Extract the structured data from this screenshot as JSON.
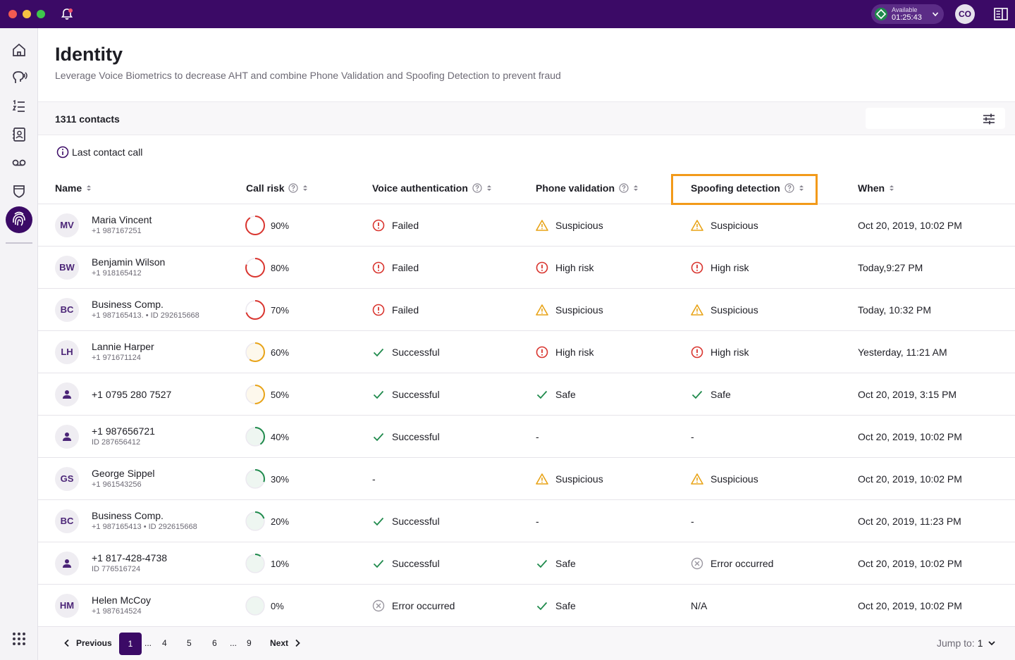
{
  "topbar": {
    "status_label": "Available",
    "status_time": "01:25:43",
    "user_initials": "CO"
  },
  "sidebar": {
    "items": [
      "home-icon",
      "speech-icon",
      "list-icon",
      "contacts-icon",
      "voicemail-icon",
      "shield-icon",
      "fingerprint-icon"
    ],
    "active": "fingerprint-icon"
  },
  "page": {
    "title": "Identity",
    "subtitle": "Leverage Voice Biometrics to decrease AHT and combine Phone Validation and Spoofing Detection to prevent fraud",
    "count": "1311 contacts",
    "info": "Last contact call"
  },
  "table": {
    "headers": {
      "name": "Name",
      "call_risk": "Call risk",
      "voice": "Voice authentication",
      "phone": "Phone validation",
      "spoof": "Spoofing detection",
      "when": "When"
    },
    "rows": [
      {
        "initials": "MV",
        "name": "Maria Vincent",
        "sub": "+1 987167251",
        "risk": "90%",
        "risk_value": 0.9,
        "voice": {
          "status": "failed",
          "text": "Failed"
        },
        "phone": {
          "status": "suspicious",
          "text": "Suspicious"
        },
        "spoof": {
          "status": "suspicious",
          "text": "Suspicious"
        },
        "when": "Oct 20, 2019, 10:02 PM"
      },
      {
        "initials": "BW",
        "name": "Benjamin Wilson",
        "sub": "+1 918165412",
        "risk": "80%",
        "risk_value": 0.8,
        "voice": {
          "status": "failed",
          "text": "Failed"
        },
        "phone": {
          "status": "high",
          "text": "High risk"
        },
        "spoof": {
          "status": "high",
          "text": "High risk"
        },
        "when": "Today,9:27 PM"
      },
      {
        "initials": "BC",
        "name": "Business Comp.",
        "sub": "+1 987165413. • ID 292615668",
        "risk": "70%",
        "risk_value": 0.7,
        "voice": {
          "status": "failed",
          "text": "Failed"
        },
        "phone": {
          "status": "suspicious",
          "text": "Suspicious"
        },
        "spoof": {
          "status": "suspicious",
          "text": "Suspicious"
        },
        "when": "Today, 10:32 PM"
      },
      {
        "initials": "LH",
        "name": "Lannie Harper",
        "sub": "+1 971671124",
        "risk": "60%",
        "risk_value": 0.6,
        "voice": {
          "status": "success",
          "text": "Successful"
        },
        "phone": {
          "status": "high",
          "text": "High risk"
        },
        "spoof": {
          "status": "high",
          "text": "High risk"
        },
        "when": "Yesterday, 11:21 AM"
      },
      {
        "initials": "",
        "name": "+1 0795 280 7527",
        "sub": "",
        "risk": "50%",
        "risk_value": 0.5,
        "voice": {
          "status": "success",
          "text": "Successful"
        },
        "phone": {
          "status": "success",
          "text": "Safe"
        },
        "spoof": {
          "status": "success",
          "text": "Safe"
        },
        "when": "Oct 20, 2019, 3:15 PM"
      },
      {
        "initials": "",
        "name": "+1 987656721",
        "sub": "ID 287656412",
        "risk": "40%",
        "risk_value": 0.4,
        "voice": {
          "status": "success",
          "text": "Successful"
        },
        "phone": {
          "status": "none",
          "text": "-"
        },
        "spoof": {
          "status": "none",
          "text": "-"
        },
        "when": "Oct 20, 2019, 10:02 PM"
      },
      {
        "initials": "GS",
        "name": "George Sippel",
        "sub": "+1 961543256",
        "risk": "30%",
        "risk_value": 0.3,
        "voice": {
          "status": "none",
          "text": "-"
        },
        "phone": {
          "status": "suspicious",
          "text": "Suspicious"
        },
        "spoof": {
          "status": "suspicious",
          "text": "Suspicious"
        },
        "when": "Oct 20, 2019, 10:02 PM"
      },
      {
        "initials": "BC",
        "name": "Business Comp.",
        "sub": "+1 987165413 • ID 292615668",
        "risk": "20%",
        "risk_value": 0.2,
        "voice": {
          "status": "success",
          "text": "Successful"
        },
        "phone": {
          "status": "none",
          "text": "-"
        },
        "spoof": {
          "status": "none",
          "text": "-"
        },
        "when": "Oct 20, 2019, 11:23 PM"
      },
      {
        "initials": "",
        "name": "+1 817-428-4738",
        "sub": "ID 776516724",
        "risk": "10%",
        "risk_value": 0.1,
        "voice": {
          "status": "success",
          "text": "Successful"
        },
        "phone": {
          "status": "success",
          "text": "Safe"
        },
        "spoof": {
          "status": "error",
          "text": "Error occurred"
        },
        "when": "Oct 20, 2019, 10:02 PM"
      },
      {
        "initials": "HM",
        "name": "Helen McCoy",
        "sub": "+1 987614524",
        "risk": "0%",
        "risk_value": 0.0,
        "voice": {
          "status": "error",
          "text": "Error occurred"
        },
        "phone": {
          "status": "success",
          "text": "Safe"
        },
        "spoof": {
          "status": "none",
          "text": "N/A"
        },
        "when": "Oct 20, 2019, 10:02 PM"
      }
    ]
  },
  "pagination": {
    "previous": "Previous",
    "next": "Next",
    "current": "1",
    "ellipsis": "...",
    "pages": [
      "4",
      "5",
      "6",
      "9"
    ],
    "jump_label": "Jump to:",
    "jump_value": "1"
  },
  "colors": {
    "brand": "#3b0a66",
    "danger": "#d9352f",
    "warning": "#e8a317",
    "success": "#1f8a4c",
    "neutral": "#9a97a0",
    "highlight": "#f29a1a"
  }
}
